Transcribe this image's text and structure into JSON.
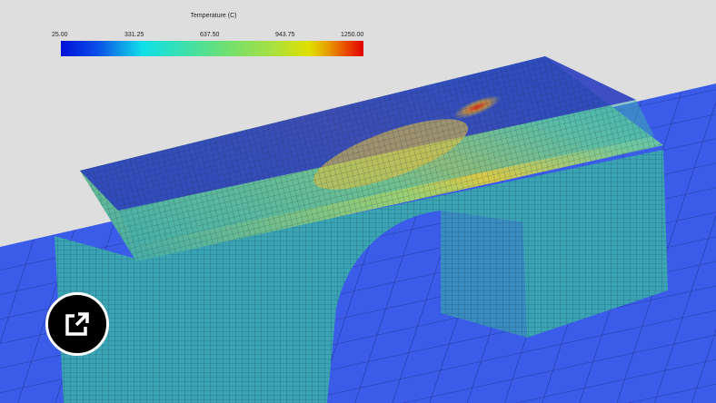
{
  "legend": {
    "title": "Temperature (C)",
    "ticks": [
      "25.00",
      "331.25",
      "637.50",
      "943.75",
      "1250.00"
    ],
    "range": [
      25,
      1250
    ],
    "colors": [
      "#0010d8",
      "#10e0e8",
      "#70e070",
      "#e0e000",
      "#e00000"
    ]
  },
  "colors": {
    "background": "#dedede",
    "ground": "#3a5ce8",
    "cold": "#2b3fbf",
    "body": "#3fb8b0",
    "hot": "#e03020"
  },
  "external_link_icon": "external-link-icon"
}
